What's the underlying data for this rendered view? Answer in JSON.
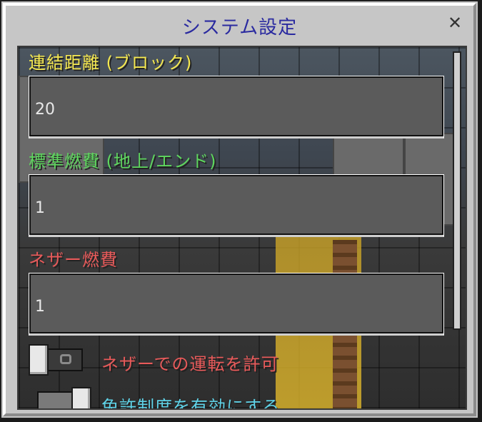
{
  "dialog": {
    "title": "システム設定",
    "close_label": "✕"
  },
  "settings": {
    "link_distance": {
      "label": "連結距離 (ブロック)",
      "value": "20",
      "color": "#f5e850"
    },
    "standard_fuel": {
      "label": "標準燃費 (地上/エンド)",
      "value": "1",
      "color": "#5ed65e"
    },
    "nether_fuel": {
      "label": "ネザー燃費",
      "value": "1",
      "color": "#e85a5a"
    },
    "allow_nether": {
      "label": "ネザーでの運転を許可",
      "state": "off",
      "color": "#e85a5a"
    },
    "license_system": {
      "label": "免許制度を有効にする",
      "state": "on",
      "color": "#5fd3e8"
    }
  },
  "icons": {
    "close": "close-icon"
  }
}
